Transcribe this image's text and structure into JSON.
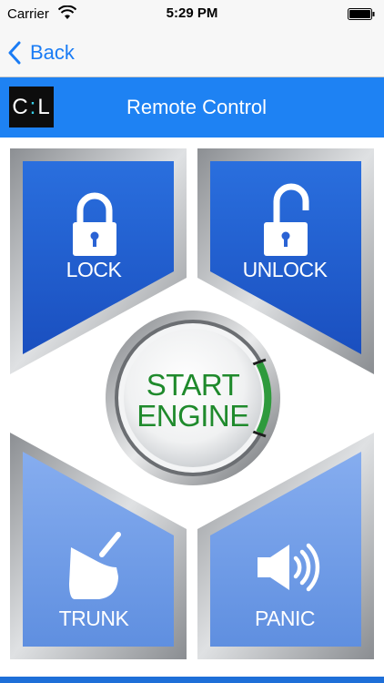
{
  "status_bar": {
    "carrier": "Carrier",
    "time": "5:29 PM"
  },
  "nav": {
    "back_label": "Back"
  },
  "header": {
    "logo_left": "C",
    "logo_dot": ":",
    "logo_right": "L",
    "title": "Remote Control"
  },
  "controls": {
    "lock_label": "LOCK",
    "unlock_label": "UNLOCK",
    "start_line1": "START",
    "start_line2": "ENGINE",
    "trunk_label": "TRUNK",
    "panic_label": "PANIC"
  },
  "colors": {
    "accent": "#1e82f3",
    "pad_active": "#1f5fd0",
    "pad_inactive": "#6f9be6",
    "start_text": "#1f8a2c"
  },
  "icons": {
    "lock": "padlock-closed-icon",
    "unlock": "padlock-open-icon",
    "trunk": "car-trunk-icon",
    "panic": "speaker-icon",
    "back": "chevron-left-icon",
    "wifi": "wifi-icon",
    "battery": "battery-icon"
  }
}
